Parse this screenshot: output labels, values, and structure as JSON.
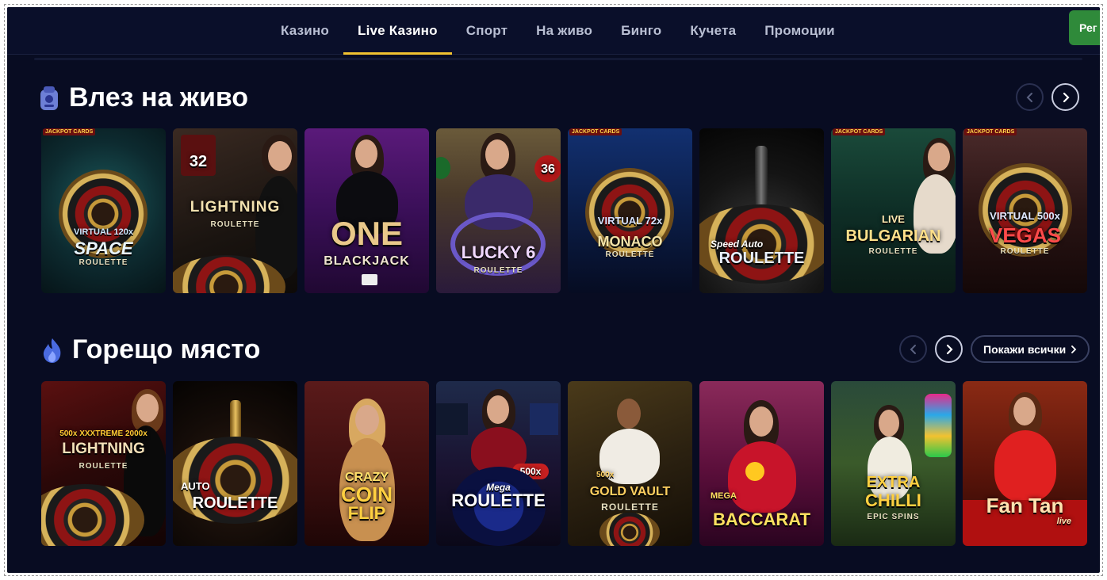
{
  "nav": {
    "items": [
      "Казино",
      "Live Казино",
      "Спорт",
      "На живо",
      "Бинго",
      "Кучета",
      "Промоции"
    ],
    "active_index": 1,
    "register_label": "Рег"
  },
  "section_live": {
    "title": "Влез на живо",
    "icon": "live-badge-icon",
    "games": [
      {
        "name": "Virtual 120x Space Roulette",
        "line1": "VIRTUAL 120x",
        "line2": "SPACE",
        "line3": "ROULETTE",
        "badge": "JACKPOT CARDS"
      },
      {
        "name": "Lightning Roulette",
        "line1": "32",
        "line2": "LIGHTNING",
        "line3": "ROULETTE",
        "badge": ""
      },
      {
        "name": "One Blackjack",
        "line1": "",
        "line2": "ONE",
        "line3": "BLACKJACK",
        "badge": ""
      },
      {
        "name": "Lucky 6 Roulette",
        "line1": "36",
        "line2": "LUCKY 6",
        "line3": "ROULETTE",
        "badge": ""
      },
      {
        "name": "Virtual 72x Monaco Roulette",
        "line1": "VIRTUAL 72x",
        "line2": "MONACO",
        "line3": "ROULETTE",
        "badge": "JACKPOT CARDS"
      },
      {
        "name": "Speed Auto Roulette",
        "line1": "Speed Auto",
        "line2": "ROULETTE",
        "line3": "",
        "badge": ""
      },
      {
        "name": "Live Bulgarian Roulette",
        "line1": "LIVE",
        "line2": "BULGARIAN",
        "line3": "ROULETTE",
        "badge": "JACKPOT CARDS"
      },
      {
        "name": "Virtual 500x Vegas Roulette",
        "line1": "VIRTUAL 500x",
        "line2": "VEGAS",
        "line3": "ROULETTE",
        "badge": "JACKPOT CARDS"
      }
    ]
  },
  "section_hot": {
    "title": "Горещо място",
    "icon": "fire-icon",
    "show_all_label": "Покажи всички",
    "games": [
      {
        "name": "XXXtreme Lightning Roulette",
        "line1": "500x XXXTREME 2000x",
        "line2": "LIGHTNING",
        "line3": "ROULETTE"
      },
      {
        "name": "Auto Roulette",
        "line1": "AUTO",
        "line2": "ROULETTE",
        "line3": ""
      },
      {
        "name": "Crazy Coin Flip",
        "line1": "CRAZY",
        "line2": "COIN",
        "line3": "FLIP"
      },
      {
        "name": "Mega Roulette",
        "line1": "500x",
        "line2": "Mega",
        "line3": "ROULETTE"
      },
      {
        "name": "Gold Vault Roulette",
        "line1": "500x",
        "line2": "GOLD VAULT",
        "line3": "ROULETTE"
      },
      {
        "name": "Mega Baccarat",
        "line1": "MEGA",
        "line2": "BACCARAT",
        "line3": ""
      },
      {
        "name": "Extra Chilli Epic Spins",
        "line1": "EXTRA",
        "line2": "CHILLI",
        "line3": "EPIC SPINS"
      },
      {
        "name": "Fan Tan",
        "line1": "",
        "line2": "Fan Tan",
        "line3": "live"
      }
    ]
  },
  "colors": {
    "background": "#080c22",
    "nav_active_underline": "#f2c230",
    "register_button": "#2f8a3a"
  }
}
